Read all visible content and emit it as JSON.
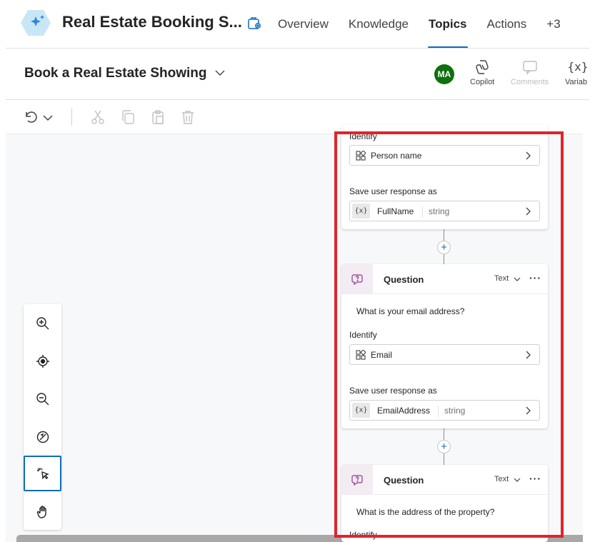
{
  "app": {
    "title": "Real Estate Booking S..."
  },
  "tabs": [
    {
      "label": "Overview",
      "active": false
    },
    {
      "label": "Knowledge",
      "active": false
    },
    {
      "label": "Topics",
      "active": true
    },
    {
      "label": "Actions",
      "active": false
    },
    {
      "label": "+3",
      "active": false
    }
  ],
  "topic": {
    "title": "Book a Real Estate Showing"
  },
  "user": {
    "initials": "MA",
    "avatar_color": "#0e700e"
  },
  "tools": {
    "copilot": "Copilot",
    "comments": "Comments",
    "variables": "Variab"
  },
  "canvas": {
    "node1": {
      "identify_label": "Identify",
      "entity": "Person name",
      "save_label": "Save user response as",
      "var_name": "FullName",
      "var_type": "string"
    },
    "node2": {
      "title": "Question",
      "type": "Text",
      "more": "···",
      "prompt": "What is your email address?",
      "identify_label": "Identify",
      "entity": "Email",
      "save_label": "Save user response as",
      "var_name": "EmailAddress",
      "var_type": "string"
    },
    "node3": {
      "title": "Question",
      "type": "Text",
      "more": "···",
      "prompt": "What is the address of the property?",
      "identify_label": "Identify"
    },
    "var_glyph": "{x}",
    "add_glyph": "+"
  },
  "colors": {
    "accent": "#0f6cbd",
    "highlight": "#e3222a",
    "question_tint": "#f3ecf3"
  }
}
